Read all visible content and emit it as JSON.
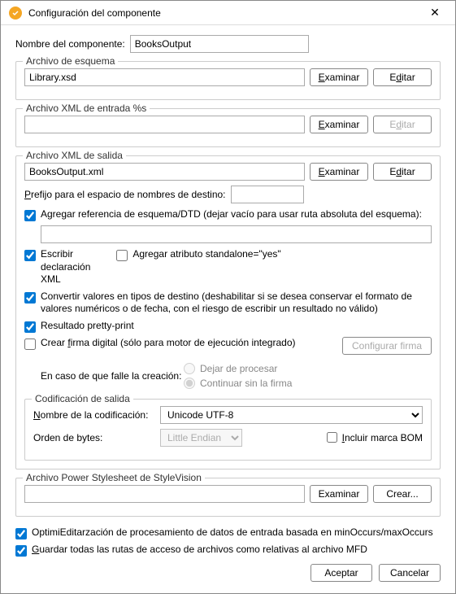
{
  "window": {
    "title": "Configuración del componente"
  },
  "component_name": {
    "label": "Nombre del componente:",
    "value": "BooksOutput"
  },
  "schema_file": {
    "legend": "Archivo de esquema",
    "value": "Library.xsd",
    "browse": "Examinar",
    "edit": "Editar"
  },
  "input_xml": {
    "legend": "Archivo XML de entrada %s",
    "value": "",
    "browse": "Examinar",
    "edit": "Editar"
  },
  "output_xml": {
    "legend": "Archivo XML de salida",
    "value": "BooksOutput.xml",
    "browse": "Examinar",
    "edit": "Editar",
    "prefix_label": "Prefijo para el espacio de nombres de destino:",
    "prefix_value": "",
    "add_schema_ref": "Agregar referencia de esquema/DTD (dejar vacío para usar ruta absoluta del esquema):",
    "add_schema_ref_value": "",
    "write_decl": "Escribir declaración XML",
    "add_standalone": "Agregar atributo standalone=\"yes\"",
    "cast_values": "Convertir valores en tipos de destino (deshabilitar si se desea conservar el formato de valores numéricos o de fecha, con el riesgo de escribir un resultado no válido)",
    "pretty_print": "Resultado pretty-print",
    "create_signature": "Crear firma digital (sólo para motor de ejecución integrado)",
    "configure_sig": "Configurar firma",
    "on_fail_label": "En caso de que falle la creación:",
    "on_fail_stop": "Dejar de procesar",
    "on_fail_continue": "Continuar sin la firma",
    "encoding_legend": "Codificación de salida",
    "encoding_name_label": "Nombre de la codificación:",
    "encoding_name_value": "Unicode UTF-8",
    "byte_order_label": "Orden de bytes:",
    "byte_order_value": "Little Endian",
    "include_bom": "Incluir marca BOM"
  },
  "stylevision": {
    "legend": "Archivo Power Stylesheet de StyleVision",
    "value": "",
    "browse": "Examinar",
    "create": "Crear..."
  },
  "options": {
    "optimize": "OptimiEditarzación de procesamiento de datos de entrada basada en minOccurs/maxOccurs",
    "save_paths": "Guardar todas las rutas de acceso de archivos como relativas al archivo MFD"
  },
  "footer": {
    "ok": "Aceptar",
    "cancel": "Cancelar"
  }
}
